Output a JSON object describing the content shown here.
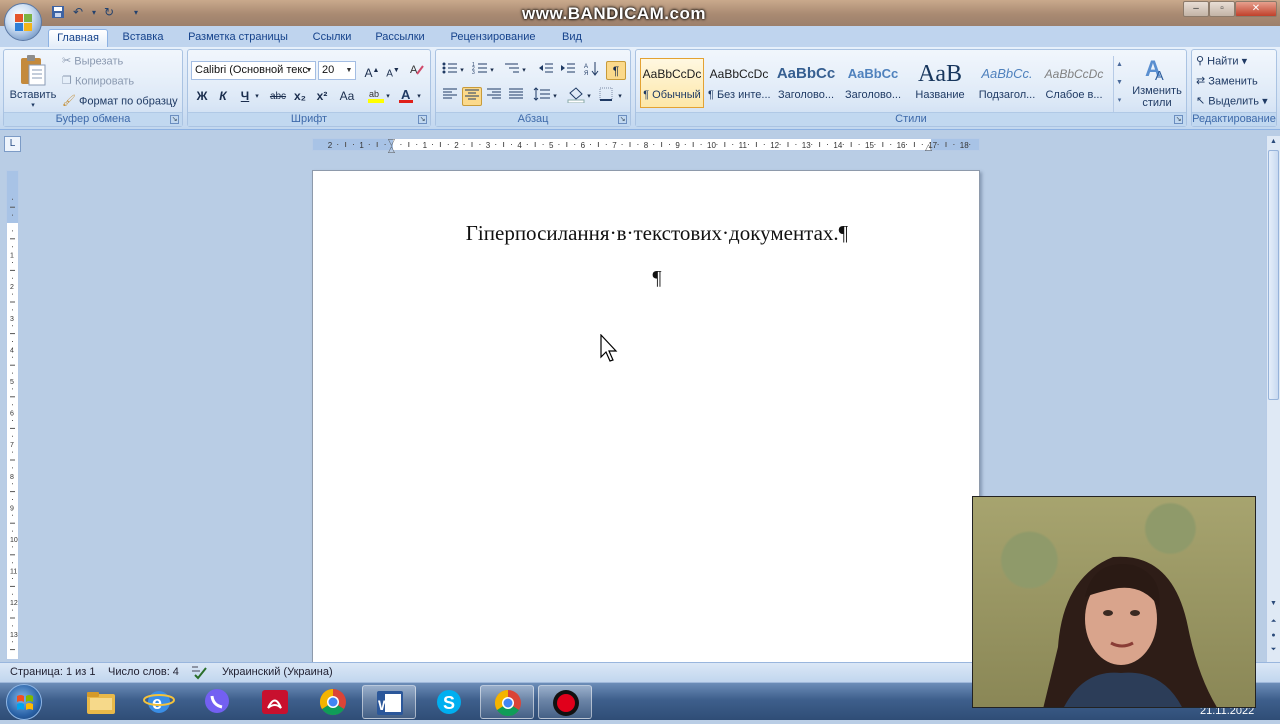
{
  "window": {
    "watermark": "www.BANDICAM.com",
    "controls": [
      "–",
      "▫",
      "✕"
    ]
  },
  "ribbon": {
    "tabs": [
      {
        "label": "Главная",
        "active": true
      },
      {
        "label": "Вставка"
      },
      {
        "label": "Разметка страницы"
      },
      {
        "label": "Ссылки"
      },
      {
        "label": "Рассылки"
      },
      {
        "label": "Рецензирование"
      },
      {
        "label": "Вид"
      }
    ],
    "clipboard": {
      "group_label": "Буфер обмена",
      "paste": "Вставить",
      "cut": "Вырезать",
      "copy": "Копировать",
      "format_painter": "Формат по образцу"
    },
    "font": {
      "group_label": "Шрифт",
      "font_name": "Calibri (Основной текс",
      "font_size": "20",
      "buttons": [
        "Ж",
        "К",
        "Ч",
        "abc",
        "x₂",
        "x²",
        "Aa"
      ]
    },
    "paragraph": {
      "group_label": "Абзац"
    },
    "styles": {
      "group_label": "Стили",
      "items": [
        {
          "sample": "AaBbCcDc",
          "name": "¶ Обычный",
          "selected": true
        },
        {
          "sample": "AaBbCcDc",
          "name": "¶ Без инте..."
        },
        {
          "sample": "AaBbCc",
          "name": "Заголово..."
        },
        {
          "sample": "AaBbCc",
          "name": "Заголово..."
        },
        {
          "sample": "AaB",
          "name": "Название"
        },
        {
          "sample": "AaBbCc.",
          "name": "Подзагол..."
        },
        {
          "sample": "AaBbCcDc",
          "name": "Слабое в..."
        }
      ],
      "change_styles": "Изменить стили"
    },
    "editing": {
      "group_label": "Редактирование",
      "find": "Найти",
      "replace": "Заменить",
      "select": "Выделить"
    }
  },
  "document": {
    "title_line": "Гіперпосилання·в·текстових·документах.¶",
    "empty_para": "¶"
  },
  "statusbar": {
    "page": "Страница: 1 из 1",
    "words": "Число слов: 4",
    "language": "Украинский (Украина)"
  },
  "taskbar": {
    "apps": [
      "windows-explorer",
      "internet-explorer",
      "viber",
      "acrobat-reader",
      "chrome",
      "word",
      "skype",
      "chrome-2",
      "bandicam-record"
    ],
    "clock_date": "21.11.2022"
  },
  "colors": {
    "ribbon_bg": "#d3e2f4",
    "tab_text": "#15428b",
    "selected_style": "#fde7a8"
  }
}
